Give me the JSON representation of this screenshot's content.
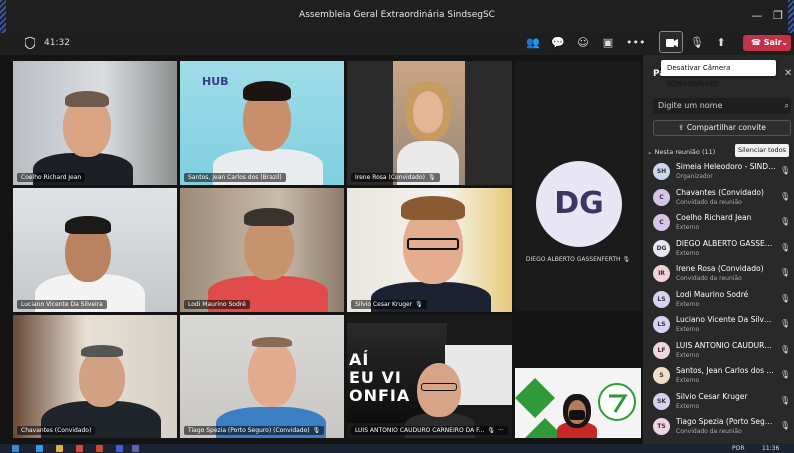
{
  "window": {
    "title": "Assembleia Geral Extraordinária SindsegSC",
    "minimize_glyph": "—",
    "maximize_glyph": "❐"
  },
  "toolbar": {
    "timer": "41:32",
    "leave_label": "Sair",
    "camera_tooltip": "Desativar Câmera (Ctrl+Shift+O)"
  },
  "tiles": [
    {
      "name": "Coelho Richard Jean"
    },
    {
      "name": "Santos, Jean Carlos dos (Brazil)"
    },
    {
      "name": "Irene Rosa (Convidado)"
    },
    {
      "name": "Luciano Vicente Da Silveira"
    },
    {
      "name": "Lodi Maurino Sodré"
    },
    {
      "name": "Silvio Cesar Kruger"
    },
    {
      "name": "Chavantes (Convidado)"
    },
    {
      "name": "Tiago Spezia (Porto Seguro) (Convidado)"
    },
    {
      "name": "LUIS ANTONIO CAUDURO CARNEIRO DA F..."
    }
  ],
  "hub_logo": "HUB",
  "dg_tile": {
    "initials": "DG",
    "name": "DIEGO ALBERTO GASSENFERTH"
  },
  "panel": {
    "title": "Pa",
    "search_placeholder": "Digite um nome",
    "share_label": "Compartilhar convite",
    "meeting_header": "Nesta reunião (11)",
    "mute_all_label": "Silenciar todos",
    "participants": [
      {
        "initials": "SH",
        "name": "Simeia Heleodoro - SINDSEG...",
        "role": "Organizador",
        "color": "#c9d7ef"
      },
      {
        "initials": "C",
        "name": "Chavantes (Convidado)",
        "role": "Convidado da reunião",
        "color": "#d8c4e8"
      },
      {
        "initials": "C",
        "name": "Coelho Richard Jean",
        "role": "Externo",
        "color": "#d8c4e8"
      },
      {
        "initials": "DG",
        "name": "DIEGO ALBERTO GASSENFERTH",
        "role": "Externo",
        "color": "#e8e5f5"
      },
      {
        "initials": "IR",
        "name": "Irene Rosa (Convidado)",
        "role": "Convidado da reunião",
        "color": "#f2d1d8"
      },
      {
        "initials": "LS",
        "name": "Lodi Maurino Sodré",
        "role": "Externo",
        "color": "#d7d2f2"
      },
      {
        "initials": "LS",
        "name": "Luciano Vicente Da Silveira",
        "role": "Externo",
        "color": "#d7d2f2"
      },
      {
        "initials": "LF",
        "name": "LUIS ANTONIO CAUDURO CA...",
        "role": "Externo",
        "color": "#f2d3e2"
      },
      {
        "initials": "S",
        "name": "Santos, Jean Carlos dos (Brazil)",
        "role": "Externo",
        "color": "#f2ddc9"
      },
      {
        "initials": "SK",
        "name": "Silvio Cesar Kruger",
        "role": "Externo",
        "color": "#d7d2f2"
      },
      {
        "initials": "TS",
        "name": "Tiago Spezia (Porto Seguro) (...",
        "role": "Convidado da reunião",
        "color": "#f2d3e2"
      }
    ]
  },
  "taskbar": {
    "lang": "POR",
    "time": "11:36"
  }
}
